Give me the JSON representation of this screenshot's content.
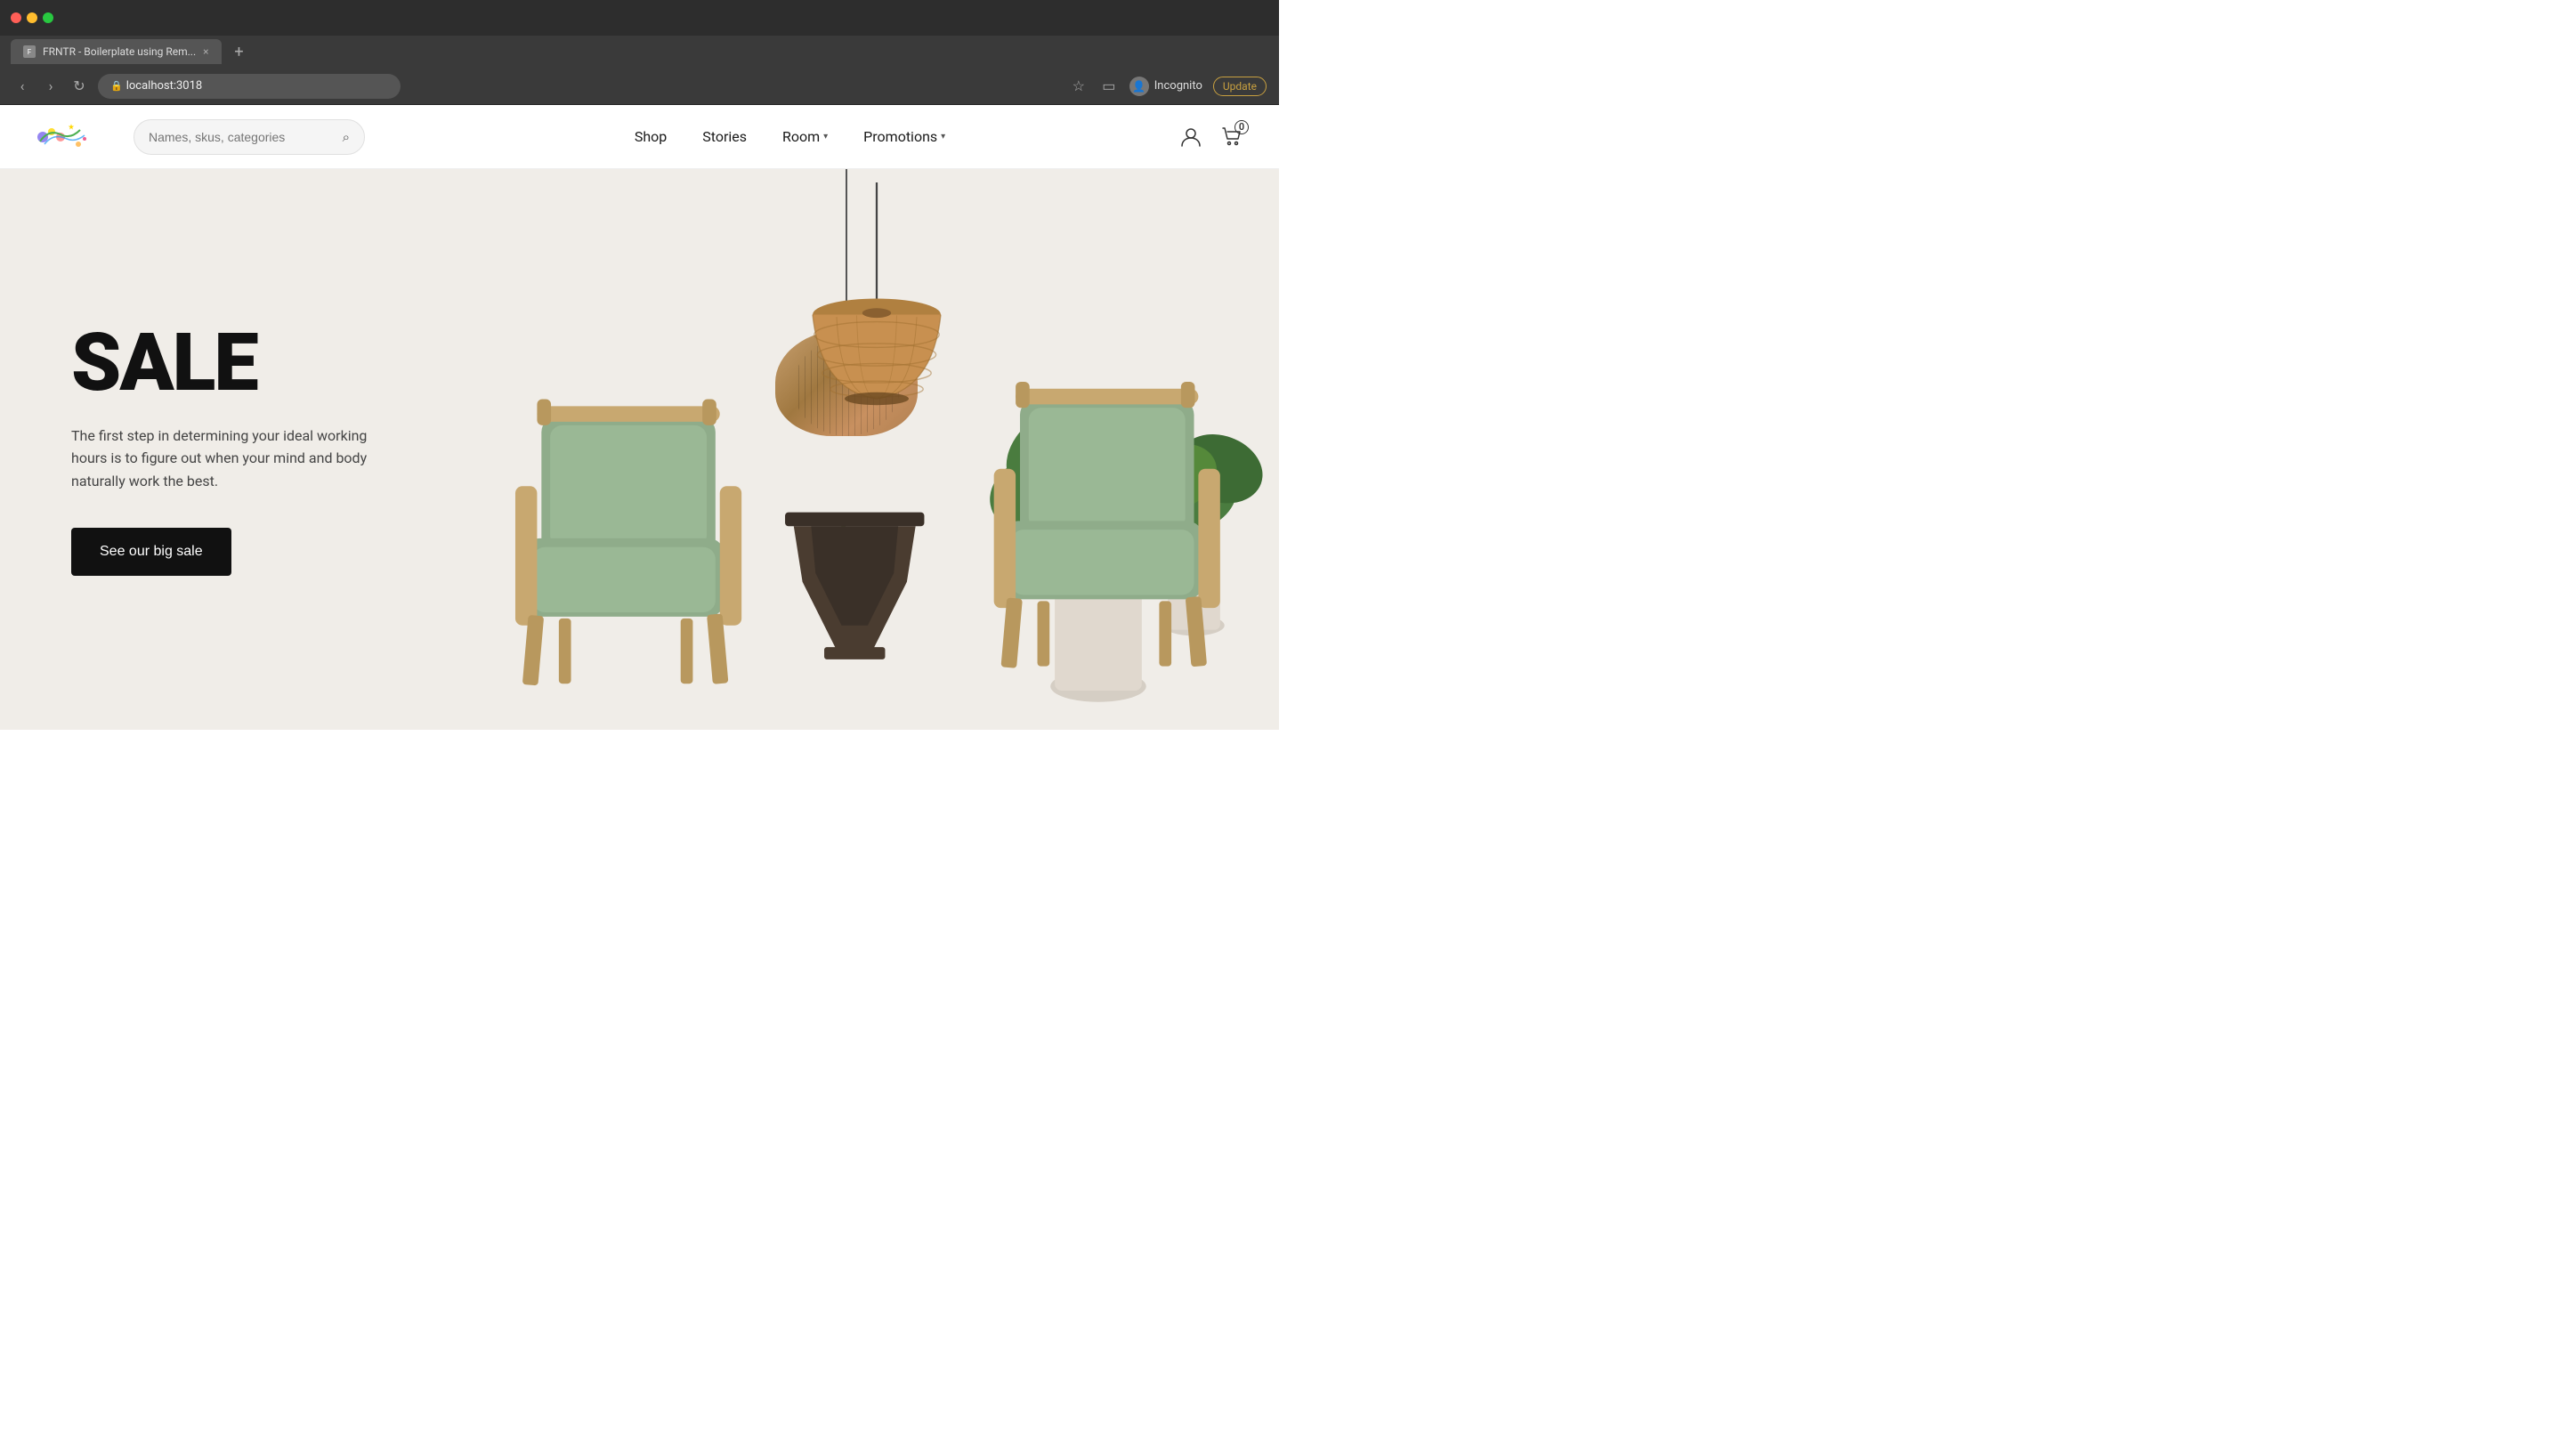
{
  "browser": {
    "tab_title": "FRNTR - Boilerplate using Rem...",
    "url": "localhost:3018",
    "tab_close": "×",
    "tab_new": "+",
    "nav_back": "‹",
    "nav_forward": "›",
    "nav_refresh": "↻",
    "star_icon": "☆",
    "sidebar_icon": "▭",
    "incognito_label": "Incognito",
    "update_label": "Update"
  },
  "nav": {
    "search_placeholder": "Names, skus, categories",
    "links": [
      {
        "label": "Shop",
        "has_dropdown": false
      },
      {
        "label": "Stories",
        "has_dropdown": false
      },
      {
        "label": "Room",
        "has_dropdown": true
      },
      {
        "label": "Promotions",
        "has_dropdown": true
      }
    ],
    "cart_count": "0"
  },
  "hero": {
    "title": "SALE",
    "subtitle": "The first step in determining your ideal working hours is to figure out when your mind and body naturally work the best.",
    "cta_label": "See our big sale"
  }
}
